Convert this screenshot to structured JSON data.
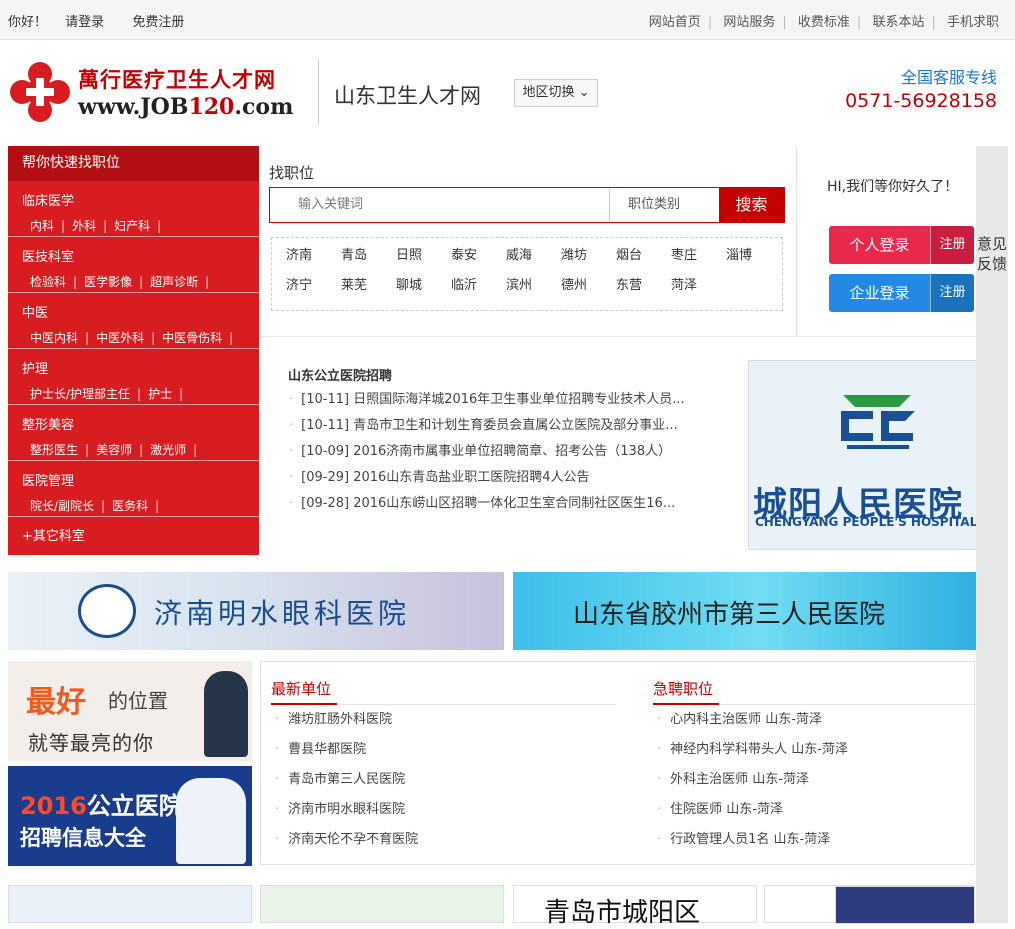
{
  "topbar": {
    "greeting": "你好！",
    "login": "请登录",
    "register": "免费注册",
    "nav": [
      "网站首页",
      "网站服务",
      "收费标准",
      "联系本站",
      "手机求职"
    ]
  },
  "header": {
    "logo_title": "萬行医疗卫生人才网",
    "logo_url_prefix": "www.JOB",
    "logo_url_number": "120",
    "logo_url_suffix": ".com",
    "site_name": "山东卫生人才网",
    "region_switch": "地区切换",
    "service_label": "全国客服专线",
    "service_phone": "0571-56928158"
  },
  "sidebar": {
    "title": "帮你快速找职位",
    "categories": [
      {
        "name": "临床医学",
        "subs": [
          "内科",
          "外科",
          "妇产科"
        ]
      },
      {
        "name": "医技科室",
        "subs": [
          "检验科",
          "医学影像",
          "超声诊断"
        ]
      },
      {
        "name": "中医",
        "subs": [
          "中医内科",
          "中医外科",
          "中医骨伤科"
        ]
      },
      {
        "name": "护理",
        "subs": [
          "护士长/护理部主任",
          "护士"
        ]
      },
      {
        "name": "整形美容",
        "subs": [
          "整形医生",
          "美容师",
          "激光师"
        ]
      },
      {
        "name": "医院管理",
        "subs": [
          "院长/副院长",
          "医务科"
        ]
      }
    ],
    "other": "+其它科室"
  },
  "search": {
    "label": "找职位",
    "keyword_placeholder": "输入关键词",
    "category": "职位类别",
    "button": "搜索",
    "cities_row1": [
      "济南",
      "青岛",
      "日照",
      "泰安",
      "威海",
      "潍坊",
      "烟台",
      "枣庄",
      "淄博"
    ],
    "cities_row2": [
      "济宁",
      "莱芜",
      "聊城",
      "临沂",
      "滨州",
      "德州",
      "东营",
      "菏泽"
    ]
  },
  "login_panel": {
    "greeting": "HI,我们等你好久了！",
    "personal_login": "个人登录",
    "personal_register": "注册",
    "company_login": "企业登录",
    "company_register": "注册"
  },
  "feedback": "意见反馈",
  "news": {
    "title": "山东公立医院招聘",
    "items": [
      "[10-11]  日照国际海洋城2016年卫生事业单位招聘专业技术人员...",
      "[10-11]  青岛市卫生和计划生育委员会直属公立医院及部分事业...",
      "[10-09]  2016济南市属事业单位招聘简章、招考公告（138人）",
      "[09-29]  2016山东青岛盐业职工医院招聘4人公告",
      "[09-28]  2016山东崂山区招聘一体化卫生室合同制社区医生16..."
    ]
  },
  "hospital_ad": {
    "name": "城阳人民医院",
    "english": "CHENGYANG PEOPLE'S HOSPITAL"
  },
  "banners": {
    "left": "济南明水眼科医院",
    "right": "山东省胶州市第三人民医院"
  },
  "ad_boxes": {
    "box1_a": "最好",
    "box1_b": "的位置",
    "box1_c": "就等最亮的你",
    "box2_year": "2016",
    "box2_a": "公立医院",
    "box2_b": "招聘信息大全"
  },
  "latest_units": {
    "title": "最新单位",
    "items": [
      "潍坊肛肠外科医院",
      "曹县华都医院",
      "青岛市第三人民医院",
      "济南市明水眼科医院",
      "济南天伦不孕不育医院"
    ]
  },
  "urgent_jobs": {
    "title": "急聘职位",
    "items": [
      "心内科主治医师 山东-菏泽",
      "神经内科学科带头人 山东-菏泽",
      "外科主治医师 山东-菏泽",
      "住院医师 山东-菏泽",
      "行政管理人员1名 山东-菏泽"
    ]
  },
  "bottom_strip": {
    "third": "青岛市城阳区"
  },
  "colors": {
    "brand_red": "#c40000",
    "sidebar_red": "#d71d21",
    "blue": "#2389e2",
    "pink": "#e8284d"
  }
}
